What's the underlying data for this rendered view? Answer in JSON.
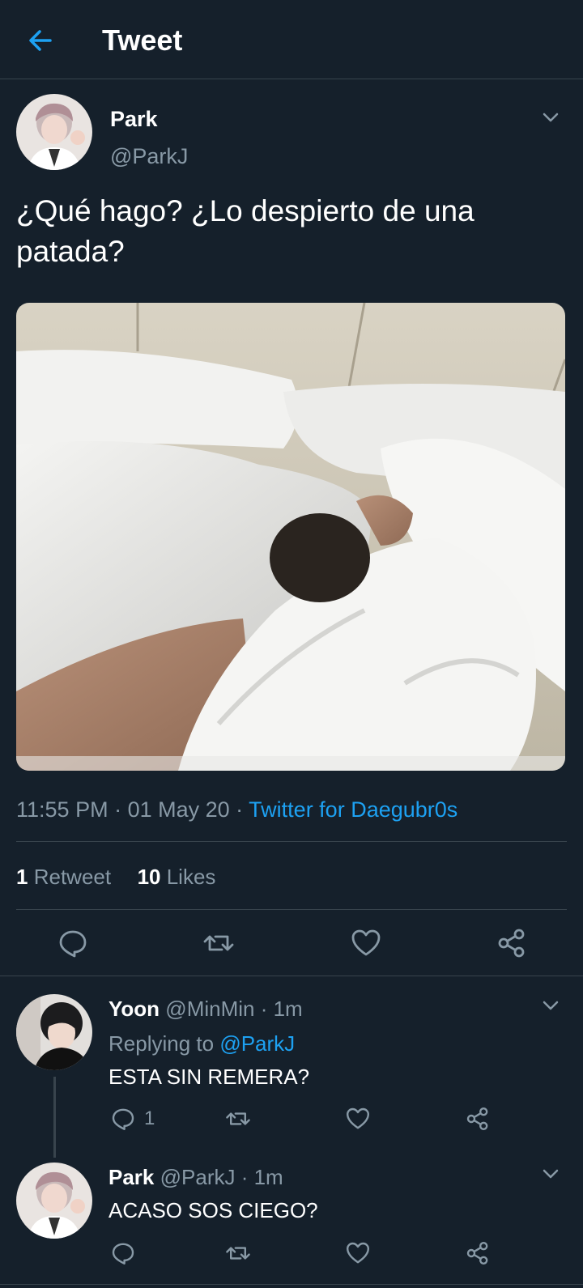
{
  "header": {
    "title": "Tweet",
    "back_icon": "arrow-left-icon"
  },
  "tweet": {
    "author_name": "Park",
    "handle": "@ParkJ",
    "text": "¿Qué hago? ¿Lo despierto de una patada?",
    "time": "11:55 PM",
    "date": "01 May 20",
    "source": "Twitter for Daegubr0s",
    "retweets_count": "1",
    "retweets_label": "Retweet",
    "likes_count": "10",
    "likes_label": "Likes"
  },
  "replies": [
    {
      "name": "Yoon",
      "handle": "@MinMin",
      "time": "1m",
      "replying_label": "Replying to",
      "replying_handle": "@ParkJ",
      "text": "ESTA SIN REMERA?",
      "reply_count": "1"
    },
    {
      "name": "Park",
      "handle": "@ParkJ",
      "time": "1m",
      "text": "ACASO SOS CIEGO?"
    }
  ],
  "colors": {
    "background": "#15202b",
    "accent": "#1da1f2",
    "muted": "#8899a6",
    "divider": "#38444d"
  }
}
